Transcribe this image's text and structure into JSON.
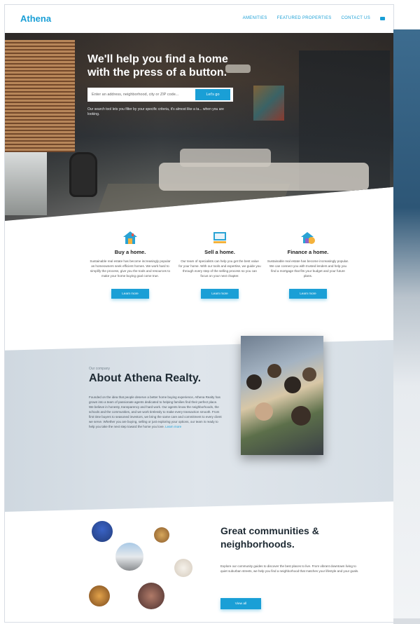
{
  "nav": {
    "brand": "Athena",
    "links": [
      "Amenities",
      "Featured Properties",
      "Contact Us"
    ]
  },
  "hero": {
    "title": "We'll help you find a home with the press of a button.",
    "search_placeholder": "Enter an address, neighborhood, city or ZIP code...",
    "search_button": "Let's go",
    "subtitle": "Our search tool lets you filter by your specific criteria, it's almost like a ta... when you are looking."
  },
  "services": [
    {
      "icon": "house-buy-icon",
      "title": "Buy a home.",
      "text": "Sustainable real estate has become increasingly popular as homeowners seek efficient homes. We work hard to simplify the process, give you the tools and resources to make your home buying goal come true.",
      "button": "Learn more"
    },
    {
      "icon": "sell-sign-icon",
      "title": "Sell a home.",
      "text": "Our team of specialists can help you get the best value for your home. With our tools and expertise, we guide you through every step of the selling process so you can focus on your next chapter.",
      "button": "Learn more"
    },
    {
      "icon": "finance-house-icon",
      "title": "Finance a home.",
      "text": "Sustainable real estate has become increasingly popular. We can connect you with trusted lenders and help you find a mortgage that fits your budget and your future plans.",
      "button": "Learn more"
    }
  ],
  "about": {
    "kicker": "Our company",
    "title": "About Athena Realty.",
    "text": "Founded on the idea that people deserve a better home buying experience, Athena Realty has grown into a team of passionate agents dedicated to helping families find their perfect place. We believe in honesty, transparency and hard work. Our agents know the neighborhoods, the schools and the communities, and we work tirelessly to make every transaction smooth. From first time buyers to seasoned investors, we bring the same care and commitment to every client we serve. Whether you are buying, selling or just exploring your options, our team is ready to help you take the next step toward the home you love.",
    "link": "Learn more"
  },
  "communities": {
    "title": "Great communities & neighborhoods.",
    "text": "Explore our community guides to discover the best places to live. From vibrant downtown living to quiet suburban streets, we help you find a neighborhood that matches your lifestyle and your goals.",
    "button": "View all"
  },
  "colors": {
    "accent": "#1a9fd6",
    "heading": "#1e2a33"
  }
}
